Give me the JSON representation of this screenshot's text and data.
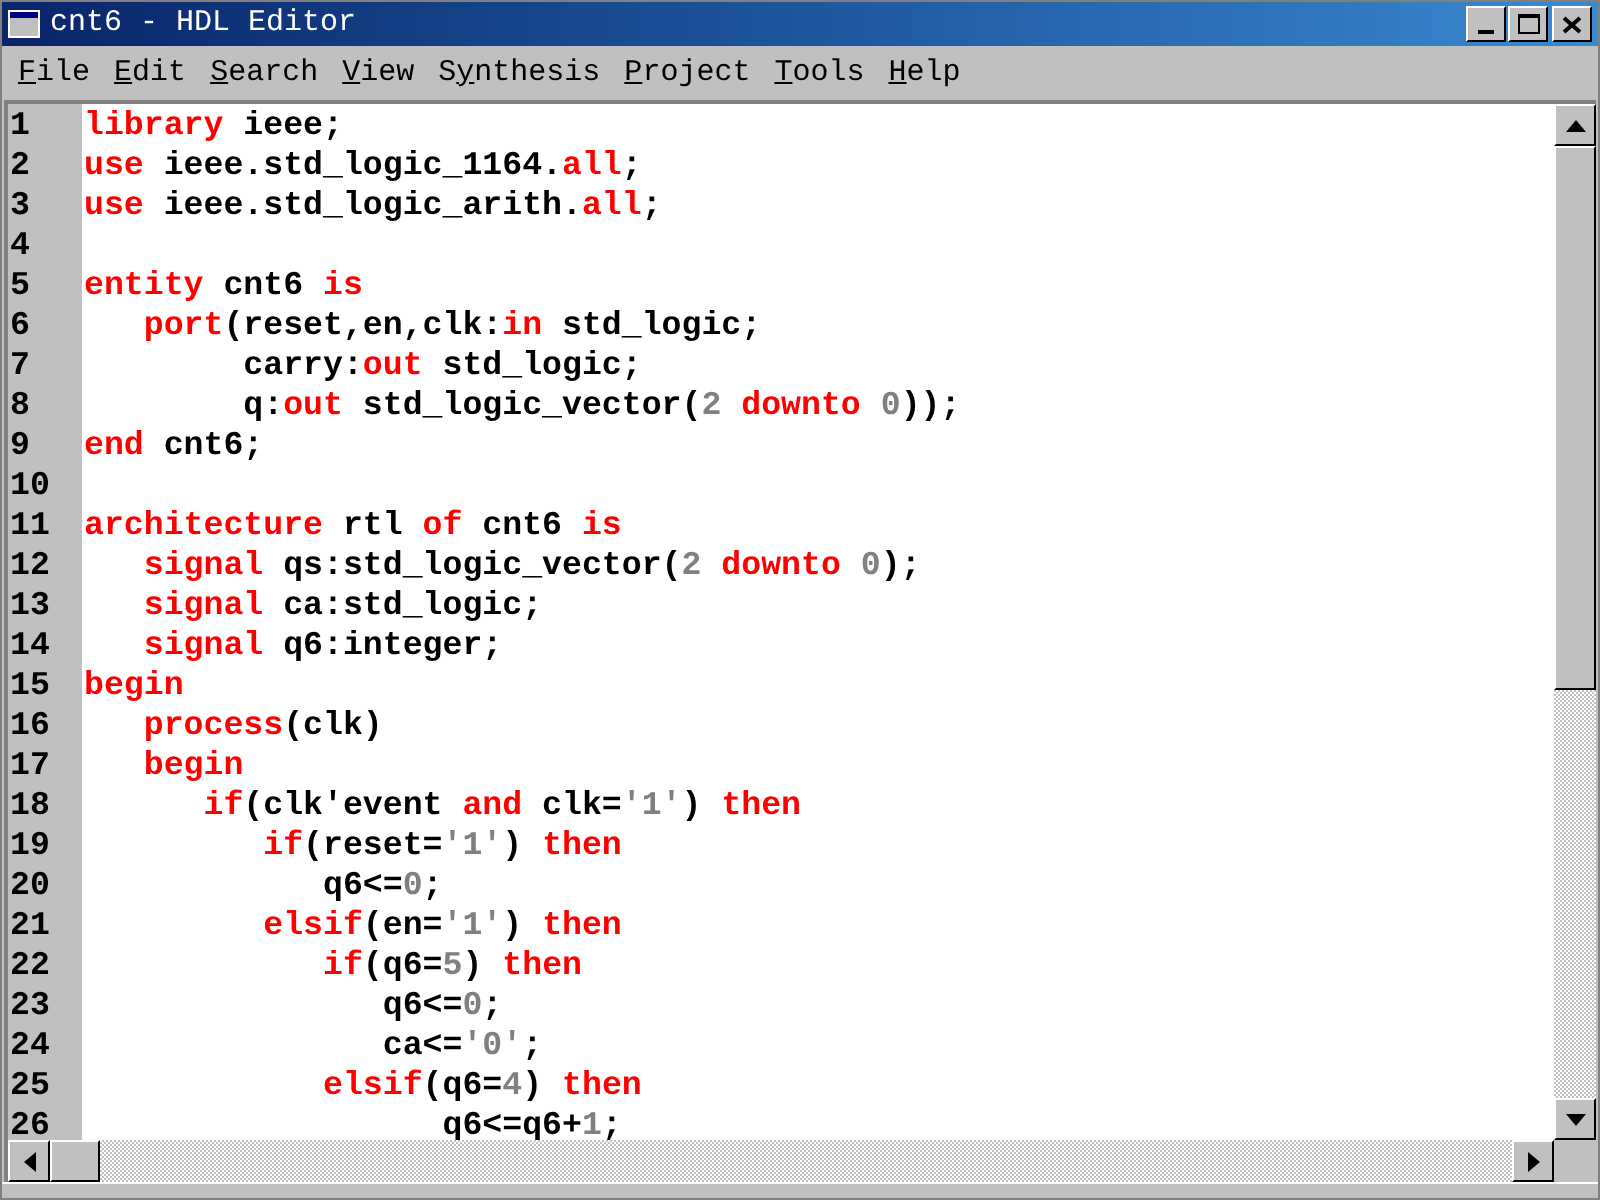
{
  "window": {
    "title": "cnt6 - HDL Editor"
  },
  "menu": [
    {
      "key": "F",
      "rest": "ile"
    },
    {
      "key": "E",
      "rest": "dit"
    },
    {
      "key": "S",
      "rest": "earch"
    },
    {
      "key": "V",
      "rest": "iew"
    },
    {
      "lead": "S",
      "key": "y",
      "rest": "nthesis"
    },
    {
      "key": "P",
      "rest": "roject"
    },
    {
      "key": "T",
      "rest": "ools"
    },
    {
      "key": "H",
      "rest": "elp"
    }
  ],
  "lines": [
    {
      "number": "1",
      "tokens": [
        {
          "kind": "keyword",
          "text": "library"
        },
        {
          "kind": "plain",
          "text": " ieee;"
        }
      ]
    },
    {
      "number": "2",
      "tokens": [
        {
          "kind": "keyword",
          "text": "use"
        },
        {
          "kind": "plain",
          "text": " ieee.std_logic_1164."
        },
        {
          "kind": "keyword",
          "text": "all"
        },
        {
          "kind": "plain",
          "text": ";"
        }
      ]
    },
    {
      "number": "3",
      "tokens": [
        {
          "kind": "keyword",
          "text": "use"
        },
        {
          "kind": "plain",
          "text": " ieee.std_logic_arith."
        },
        {
          "kind": "keyword",
          "text": "all"
        },
        {
          "kind": "plain",
          "text": ";"
        }
      ]
    },
    {
      "number": "4"
    },
    {
      "number": "5",
      "tokens": [
        {
          "kind": "keyword",
          "text": "entity"
        },
        {
          "kind": "plain",
          "text": " cnt6 "
        },
        {
          "kind": "keyword",
          "text": "is"
        }
      ]
    },
    {
      "number": "6",
      "tokens": [
        {
          "kind": "keyword",
          "text": "   port"
        },
        {
          "kind": "plain",
          "text": "(reset,en,clk:"
        },
        {
          "kind": "keyword",
          "text": "in"
        },
        {
          "kind": "plain",
          "text": " std_logic;"
        }
      ]
    },
    {
      "number": "7",
      "tokens": [
        {
          "kind": "plain",
          "text": "        carry:"
        },
        {
          "kind": "keyword",
          "text": "out"
        },
        {
          "kind": "plain",
          "text": " std_logic;"
        }
      ]
    },
    {
      "number": "8",
      "tokens": [
        {
          "kind": "plain",
          "text": "        q:"
        },
        {
          "kind": "keyword",
          "text": "out"
        },
        {
          "kind": "plain",
          "text": " std_logic_vector("
        },
        {
          "kind": "literal",
          "text": "2"
        },
        {
          "kind": "keyword",
          "text": " downto "
        },
        {
          "kind": "literal",
          "text": "0"
        },
        {
          "kind": "plain",
          "text": "));"
        }
      ]
    },
    {
      "number": "9",
      "tokens": [
        {
          "kind": "keyword",
          "text": "end"
        },
        {
          "kind": "plain",
          "text": " cnt6;"
        }
      ]
    },
    {
      "number": "10"
    },
    {
      "number": "11",
      "tokens": [
        {
          "kind": "keyword",
          "text": "architecture"
        },
        {
          "kind": "plain",
          "text": " rtl "
        },
        {
          "kind": "keyword",
          "text": "of"
        },
        {
          "kind": "plain",
          "text": " cnt6 "
        },
        {
          "kind": "keyword",
          "text": "is"
        }
      ]
    },
    {
      "number": "12",
      "tokens": [
        {
          "kind": "keyword",
          "text": "   signal"
        },
        {
          "kind": "plain",
          "text": " qs:std_logic_vector("
        },
        {
          "kind": "literal",
          "text": "2"
        },
        {
          "kind": "keyword",
          "text": " downto "
        },
        {
          "kind": "literal",
          "text": "0"
        },
        {
          "kind": "plain",
          "text": ");"
        }
      ]
    },
    {
      "number": "13",
      "tokens": [
        {
          "kind": "keyword",
          "text": "   signal"
        },
        {
          "kind": "plain",
          "text": " ca:std_logic;"
        }
      ]
    },
    {
      "number": "14",
      "tokens": [
        {
          "kind": "keyword",
          "text": "   signal"
        },
        {
          "kind": "plain",
          "text": " q6:integer;"
        }
      ]
    },
    {
      "number": "15",
      "tokens": [
        {
          "kind": "keyword",
          "text": "begin"
        }
      ]
    },
    {
      "number": "16",
      "tokens": [
        {
          "kind": "keyword",
          "text": "   process"
        },
        {
          "kind": "plain",
          "text": "(clk)"
        }
      ]
    },
    {
      "number": "17",
      "tokens": [
        {
          "kind": "keyword",
          "text": "   begin"
        }
      ]
    },
    {
      "number": "18",
      "tokens": [
        {
          "kind": "keyword",
          "text": "      if"
        },
        {
          "kind": "plain",
          "text": "(clk'event "
        },
        {
          "kind": "keyword",
          "text": "and"
        },
        {
          "kind": "plain",
          "text": " clk="
        },
        {
          "kind": "literal",
          "text": "'1'"
        },
        {
          "kind": "plain",
          "text": ") "
        },
        {
          "kind": "keyword",
          "text": "then"
        }
      ]
    },
    {
      "number": "19",
      "tokens": [
        {
          "kind": "keyword",
          "text": "         if"
        },
        {
          "kind": "plain",
          "text": "(reset="
        },
        {
          "kind": "literal",
          "text": "'1'"
        },
        {
          "kind": "plain",
          "text": ") "
        },
        {
          "kind": "keyword",
          "text": "then"
        }
      ]
    },
    {
      "number": "20",
      "tokens": [
        {
          "kind": "plain",
          "text": "            q6<="
        },
        {
          "kind": "literal",
          "text": "0"
        },
        {
          "kind": "plain",
          "text": ";"
        }
      ]
    },
    {
      "number": "21",
      "tokens": [
        {
          "kind": "keyword",
          "text": "         elsif"
        },
        {
          "kind": "plain",
          "text": "(en="
        },
        {
          "kind": "literal",
          "text": "'1'"
        },
        {
          "kind": "plain",
          "text": ") "
        },
        {
          "kind": "keyword",
          "text": "then"
        }
      ]
    },
    {
      "number": "22",
      "tokens": [
        {
          "kind": "keyword",
          "text": "            if"
        },
        {
          "kind": "plain",
          "text": "(q6="
        },
        {
          "kind": "literal",
          "text": "5"
        },
        {
          "kind": "plain",
          "text": ") "
        },
        {
          "kind": "keyword",
          "text": "then"
        }
      ]
    },
    {
      "number": "23",
      "tokens": [
        {
          "kind": "plain",
          "text": "               q6<="
        },
        {
          "kind": "literal",
          "text": "0"
        },
        {
          "kind": "plain",
          "text": ";"
        }
      ]
    },
    {
      "number": "24",
      "tokens": [
        {
          "kind": "plain",
          "text": "               ca<="
        },
        {
          "kind": "literal",
          "text": "'0'"
        },
        {
          "kind": "plain",
          "text": ";"
        }
      ]
    },
    {
      "number": "25",
      "tokens": [
        {
          "kind": "keyword",
          "text": "            elsif"
        },
        {
          "kind": "plain",
          "text": "(q6="
        },
        {
          "kind": "literal",
          "text": "4"
        },
        {
          "kind": "plain",
          "text": ") "
        },
        {
          "kind": "keyword",
          "text": "then"
        }
      ]
    },
    {
      "number": "26",
      "tokens": [
        {
          "kind": "plain",
          "text": "                  q6<=q6+"
        },
        {
          "kind": "literal",
          "text": "1"
        },
        {
          "kind": "plain",
          "text": ";"
        }
      ]
    }
  ]
}
